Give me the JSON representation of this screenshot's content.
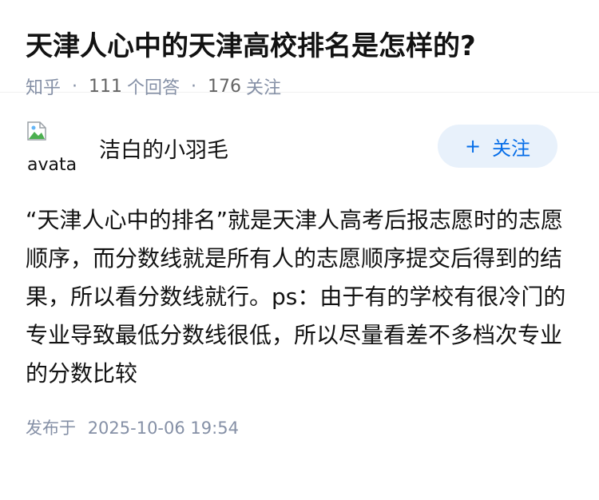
{
  "question": {
    "title": "天津人心中的天津高校排名是怎样的?",
    "source": "知乎",
    "separator": "·",
    "answer_count": "111",
    "answer_label": "个回答",
    "follower_count": "176",
    "follower_label": "关注"
  },
  "answer": {
    "author_name": "洁白的小羽毛",
    "avatar_alt": "avatar",
    "follow_button": {
      "plus": "+",
      "label": "关注"
    },
    "content": "“天津人心中的排名”就是天津人高考后报志愿时的志愿顺序，而分数线就是所有人的志愿顺序提交后得到的结果，所以看分数线就行。ps：由于有的学校有很冷门的专业导致最低分数线很低，所以尽量看差不多档次专业的分数比较",
    "published_label": "发布于",
    "published_time": "2025-10-06 19:54"
  },
  "colors": {
    "accent": "#056de8",
    "button_bg": "#e8f1fb",
    "meta_text": "#8590a6"
  },
  "icons": {
    "avatar": "broken-image-icon"
  }
}
